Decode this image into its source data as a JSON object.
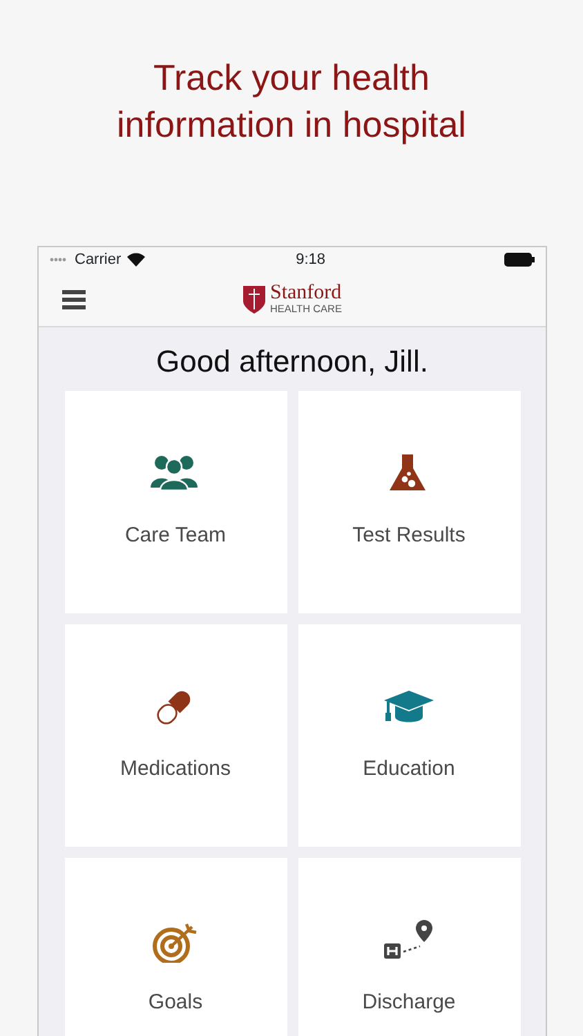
{
  "headline": "Track your health information in hospital",
  "status_bar": {
    "carrier": "Carrier",
    "time": "9:18"
  },
  "app_bar": {
    "brand": "Stanford",
    "brand_subtitle": "HEALTH CARE"
  },
  "greeting": "Good afternoon, Jill.",
  "tiles": [
    {
      "label": "Care Team"
    },
    {
      "label": "Test Results"
    },
    {
      "label": "Medications"
    },
    {
      "label": "Education"
    },
    {
      "label": "Goals"
    },
    {
      "label": "Discharge"
    }
  ]
}
